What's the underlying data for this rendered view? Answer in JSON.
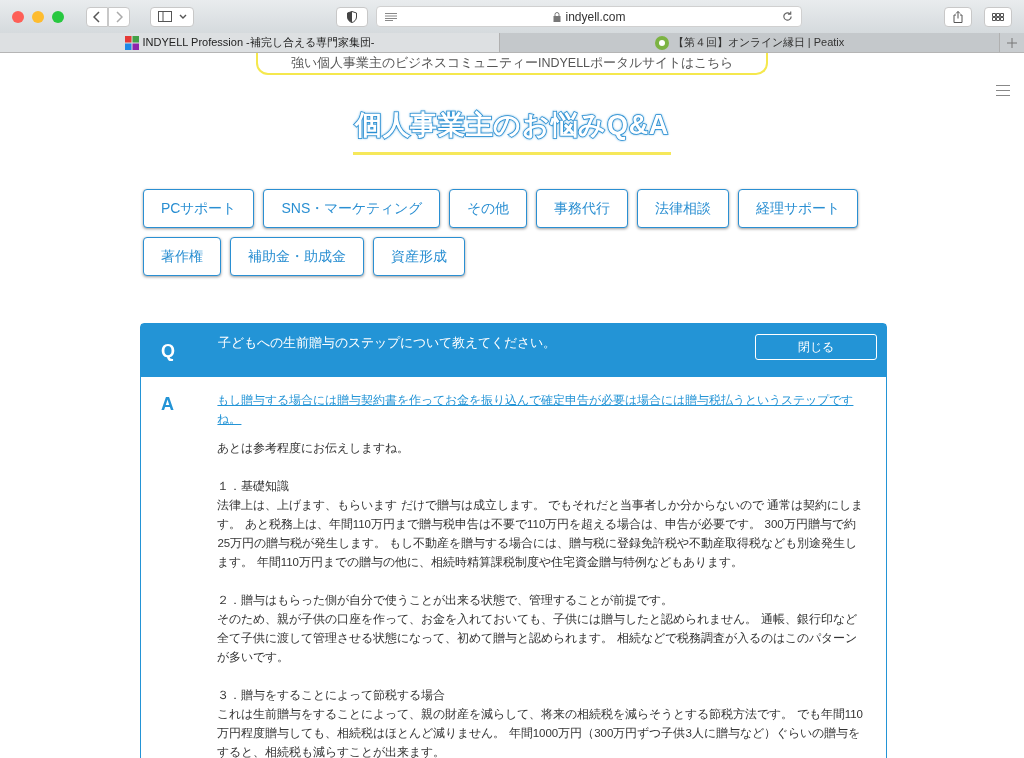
{
  "browser": {
    "url": "indyell.com",
    "tabs": [
      {
        "title": "INDYELL Profession -補完し合える専門家集団-",
        "selected": true,
        "kind": "grid"
      },
      {
        "title": "【第４回】オンライン縁日 | Peatix",
        "selected": false,
        "kind": "circle"
      }
    ]
  },
  "banner": "強い個人事業主のビジネスコミュニティーINDYELLポータルサイトはこちら",
  "page_title": "個人事業主のお悩みQ&A",
  "categories": [
    "PCサポート",
    "SNS・マーケティング",
    "その他",
    "事務代行",
    "法律相談",
    "経理サポート",
    "著作権",
    "補助金・助成金",
    "資産形成"
  ],
  "qa": {
    "q_mark": "Q",
    "question": "子どもへの生前贈与のステップについて教えてください。",
    "close_button": "閉じる",
    "a_mark": "A",
    "answer_link": "もし贈与する場合には贈与契約書を作ってお金を振り込んで確定申告が必要は場合には贈与税払うというステップですね。",
    "intro": "あとは参考程度にお伝えしますね。",
    "sections": [
      {
        "heading": "１．基礎知識",
        "body": "法律上は、上げます、もらいます だけで贈与は成立します。 でもそれだと当事者しか分からないので 通常は契約にします。 あと税務上は、年間110万円まで贈与税申告は不要で110万円を超える場合は、申告が必要です。 300万円贈与で約25万円の贈与税が発生します。 もし不動産を贈与する場合には、贈与税に登録免許税や不動産取得税なども別途発生します。 年間110万円までの贈与の他に、相続時精算課税制度や住宅資金贈与特例などもあります。"
      },
      {
        "heading": "２．贈与はもらった側が自分で使うことが出来る状態で、管理することが前提です。",
        "body": "そのため、親が子供の口座を作って、お金を入れておいても、子供には贈与したと認められません。 通帳、銀行印など全て子供に渡して管理させる状態になって、初めて贈与と認められます。 相続などで税務調査が入るのはこのパターンが多いです。"
      },
      {
        "heading": "３．贈与をすることによって節税する場合",
        "body": "これは生前贈与をすることによって、親の財産を減らして、将来の相続税を減らそうとする節税方法です。 でも年間110万円程度贈与しても、相続税はほとんど減りません。 年間1000万円（300万円ずつ子供3人に贈与など）ぐらいの贈与をすると、相続税も減らすことが出来ます。"
      }
    ]
  }
}
